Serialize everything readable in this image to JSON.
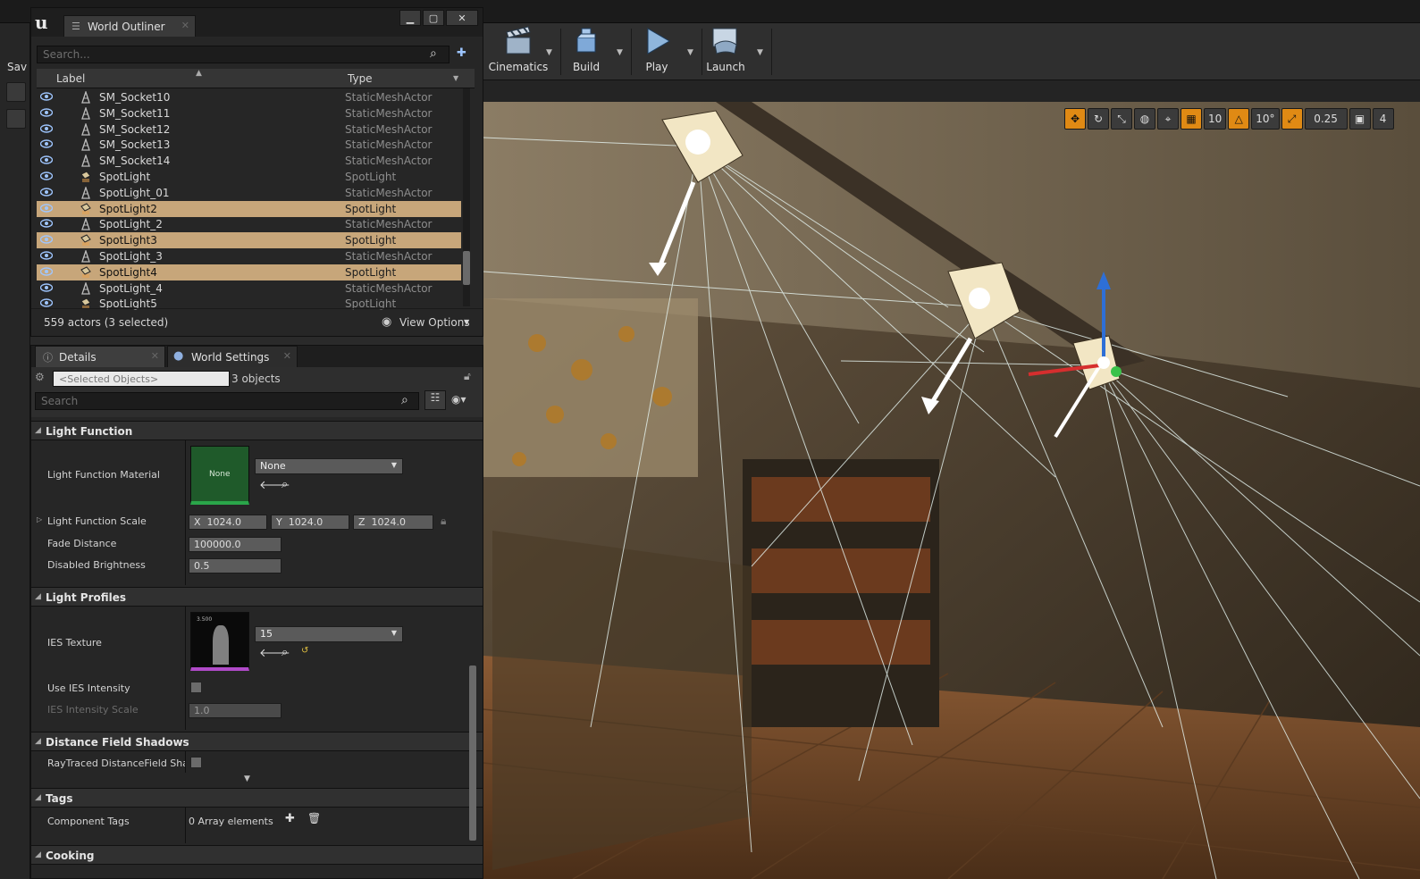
{
  "toolbar": {
    "left_cut_label": "Sav",
    "buttons": [
      {
        "label": "Cinematics",
        "icon": "clapperboard-icon"
      },
      {
        "label": "Build",
        "icon": "build-blocks-icon"
      },
      {
        "label": "Play",
        "icon": "play-icon"
      },
      {
        "label": "Launch",
        "icon": "gamepad-icon"
      }
    ]
  },
  "viewport_tools": {
    "grid_snap": "10",
    "rotation_snap": "10°",
    "scale_snap": "0.25",
    "camera_speed": "4"
  },
  "outliner": {
    "tab_title": "World Outliner",
    "search_placeholder": "Search...",
    "col_label": "Label",
    "col_type": "Type",
    "rows": [
      {
        "label": "SM_Socket10",
        "type": "StaticMeshActor",
        "selected": false
      },
      {
        "label": "SM_Socket11",
        "type": "StaticMeshActor",
        "selected": false
      },
      {
        "label": "SM_Socket12",
        "type": "StaticMeshActor",
        "selected": false
      },
      {
        "label": "SM_Socket13",
        "type": "StaticMeshActor",
        "selected": false
      },
      {
        "label": "SM_Socket14",
        "type": "StaticMeshActor",
        "selected": false
      },
      {
        "label": "SpotLight",
        "type": "SpotLight",
        "selected": false
      },
      {
        "label": "SpotLight_01",
        "type": "StaticMeshActor",
        "selected": false
      },
      {
        "label": "SpotLight2",
        "type": "SpotLight",
        "selected": true
      },
      {
        "label": "SpotLight_2",
        "type": "StaticMeshActor",
        "selected": false
      },
      {
        "label": "SpotLight3",
        "type": "SpotLight",
        "selected": true
      },
      {
        "label": "SpotLight_3",
        "type": "StaticMeshActor",
        "selected": false
      },
      {
        "label": "SpotLight4",
        "type": "SpotLight",
        "selected": true
      },
      {
        "label": "SpotLight_4",
        "type": "StaticMeshActor",
        "selected": false
      },
      {
        "label": "SpotLight5",
        "type": "SpotLight",
        "selected": false
      }
    ],
    "footer_count": "559 actors (3 selected)",
    "view_options": "View Options"
  },
  "details": {
    "tab_details": "Details",
    "tab_world_settings": "World Settings",
    "selected_objects": "<Selected Objects>",
    "objects_count": "3 objects",
    "search_placeholder": "Search",
    "sections": {
      "light_function": "Light Function",
      "light_profiles": "Light Profiles",
      "distance_field_shadows": "Distance Field Shadows",
      "tags": "Tags",
      "cooking": "Cooking"
    },
    "light_function_material": {
      "label": "Light Function Material",
      "thumb_text": "None",
      "value": "None"
    },
    "light_function_scale": {
      "label": "Light Function Scale",
      "x_label": "X",
      "x": "1024.0",
      "y_label": "Y",
      "y": "1024.0",
      "z_label": "Z",
      "z": "1024.0"
    },
    "fade_distance": {
      "label": "Fade Distance",
      "value": "100000.0"
    },
    "disabled_brightness": {
      "label": "Disabled Brightness",
      "value": "0.5"
    },
    "ies_texture": {
      "label": "IES Texture",
      "value": "15",
      "thumb_text": "3.500"
    },
    "use_ies_intensity": {
      "label": "Use IES Intensity"
    },
    "ies_intensity_scale": {
      "label": "IES Intensity Scale",
      "value": "1.0"
    },
    "raytraced": {
      "label": "RayTraced DistanceField Shado"
    },
    "component_tags": {
      "label": "Component Tags",
      "value": "0 Array elements"
    }
  }
}
